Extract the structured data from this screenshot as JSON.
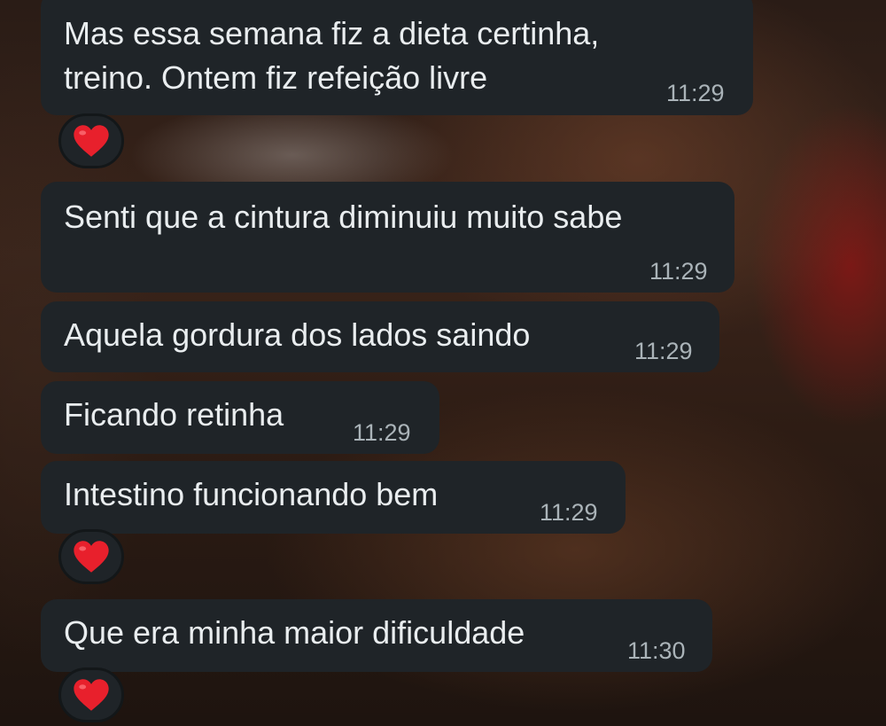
{
  "chat": {
    "messages": [
      {
        "text": "Mas essa semana fiz a dieta certinha,\ntreino. Ontem fiz refeição livre",
        "time": "11:29",
        "reaction": "heart-icon"
      },
      {
        "text": "Senti que a cintura diminuiu muito sabe",
        "time": "11:29"
      },
      {
        "text": "Aquela gordura dos lados saindo",
        "time": "11:29"
      },
      {
        "text": "Ficando retinha",
        "time": "11:29"
      },
      {
        "text": "Intestino funcionando bem",
        "time": "11:29",
        "reaction": "heart-icon"
      },
      {
        "text": "Que era minha maior dificuldade",
        "time": "11:30",
        "reaction": "heart-icon"
      }
    ]
  },
  "colors": {
    "bubble": "#1f2428",
    "text": "#e9edef",
    "time": "#aab3b8",
    "heart": "#e8202c"
  }
}
